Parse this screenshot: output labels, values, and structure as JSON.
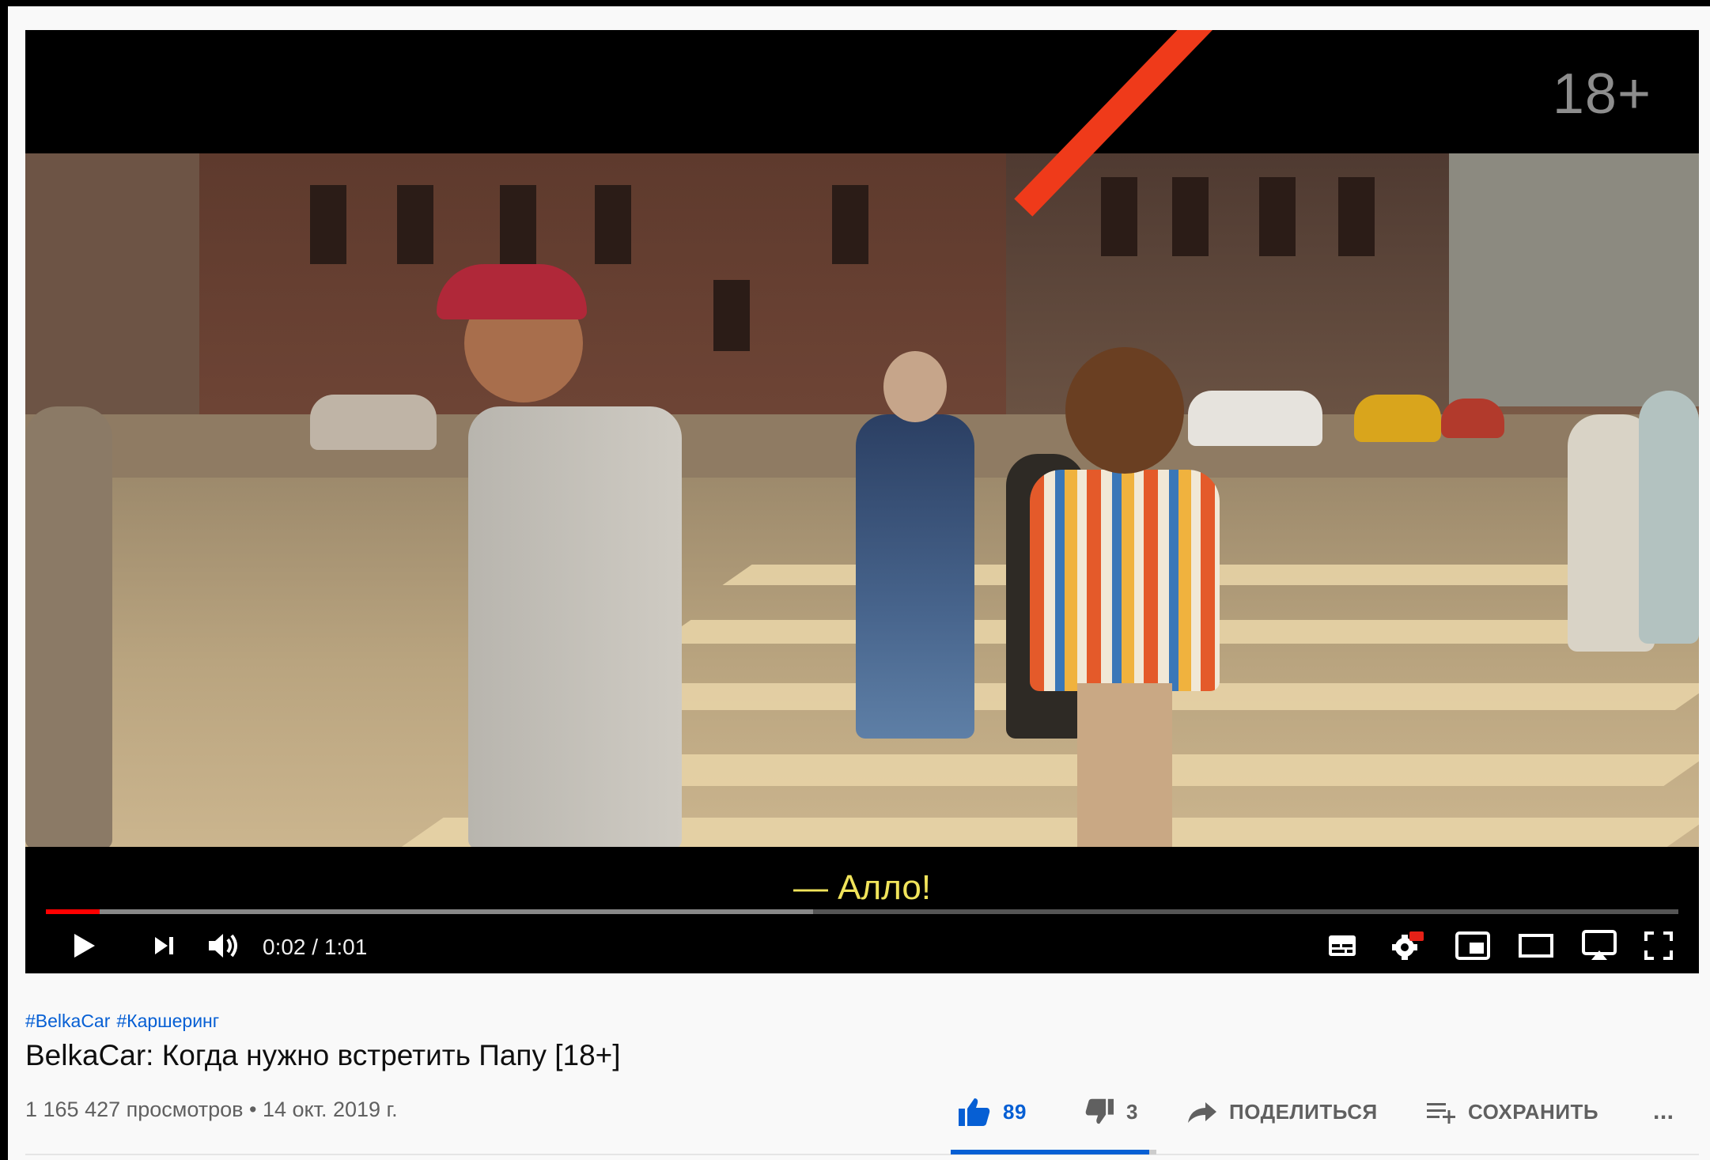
{
  "player": {
    "age_rating": "18+",
    "subtitle": "— Алло!",
    "time": "0:02 / 1:01",
    "progress_fraction": 0.033,
    "buffer_fraction": 0.47,
    "progress_color": "#ff0000"
  },
  "video": {
    "hashtags": [
      "#BelkaCar",
      "#Каршеринг"
    ],
    "title": "BelkaCar: Когда нужно встретить Папу [18+]",
    "meta": "1 165 427 просмотров • 14 окт. 2019 г."
  },
  "actions": {
    "likes": "89",
    "dislikes": "3",
    "share": "ПОДЕЛИТЬСЯ",
    "save": "СОХРАНИТЬ",
    "more": "...",
    "like_ratio": 0.967
  },
  "colors": {
    "accent_blue": "#065fd4",
    "overlay_arrow": "#ef3a1a",
    "subtitle": "#f1e45b"
  }
}
